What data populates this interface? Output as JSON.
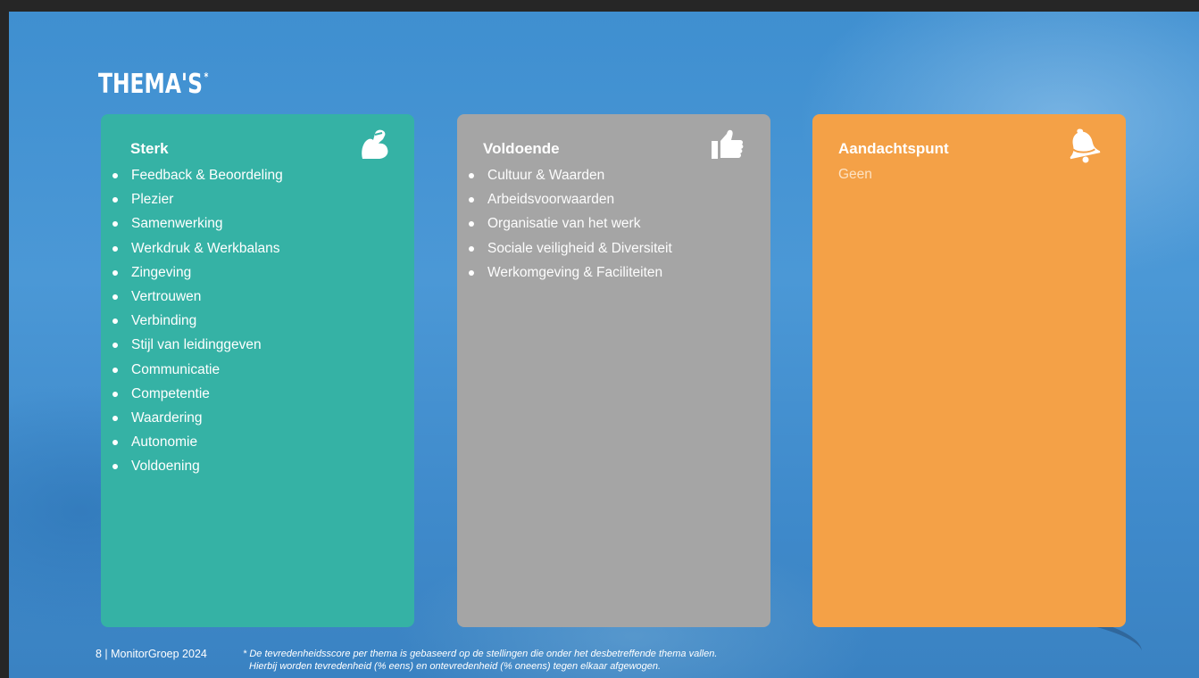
{
  "slide": {
    "title": "THEMA'S",
    "title_marker": "*",
    "cards": [
      {
        "heading": "Sterk",
        "icon": "flexed-bicep-icon",
        "color": "#35b2a5",
        "items": [
          "Feedback & Beoordeling",
          "Plezier",
          "Samenwerking",
          "Werkdruk & Werkbalans",
          "Zingeving",
          "Vertrouwen",
          "Verbinding",
          "Stijl van leidinggeven",
          "Communicatie",
          "Competentie",
          "Waardering",
          "Autonomie",
          "Voldoening"
        ]
      },
      {
        "heading": "Voldoende",
        "icon": "thumbs-up-icon",
        "color": "#a5a5a5",
        "items": [
          "Cultuur & Waarden",
          "Arbeidsvoorwaarden",
          "Organisatie van het werk",
          "Sociale veiligheid & Diversiteit",
          "Werkomgeving & Faciliteiten"
        ]
      },
      {
        "heading": "Aandachtspunt",
        "icon": "bell-icon",
        "color": "#f4a147",
        "text": "Geen"
      }
    ],
    "footer": {
      "page": "8 | MonitorGroep 2024",
      "note_line1": "* De tevredenheidsscore per thema is gebaseerd op de stellingen die onder het desbetreffende thema vallen.",
      "note_line2": "Hierbij worden tevredenheid (% eens) en ontevredenheid (% oneens) tegen elkaar afgewogen."
    }
  }
}
